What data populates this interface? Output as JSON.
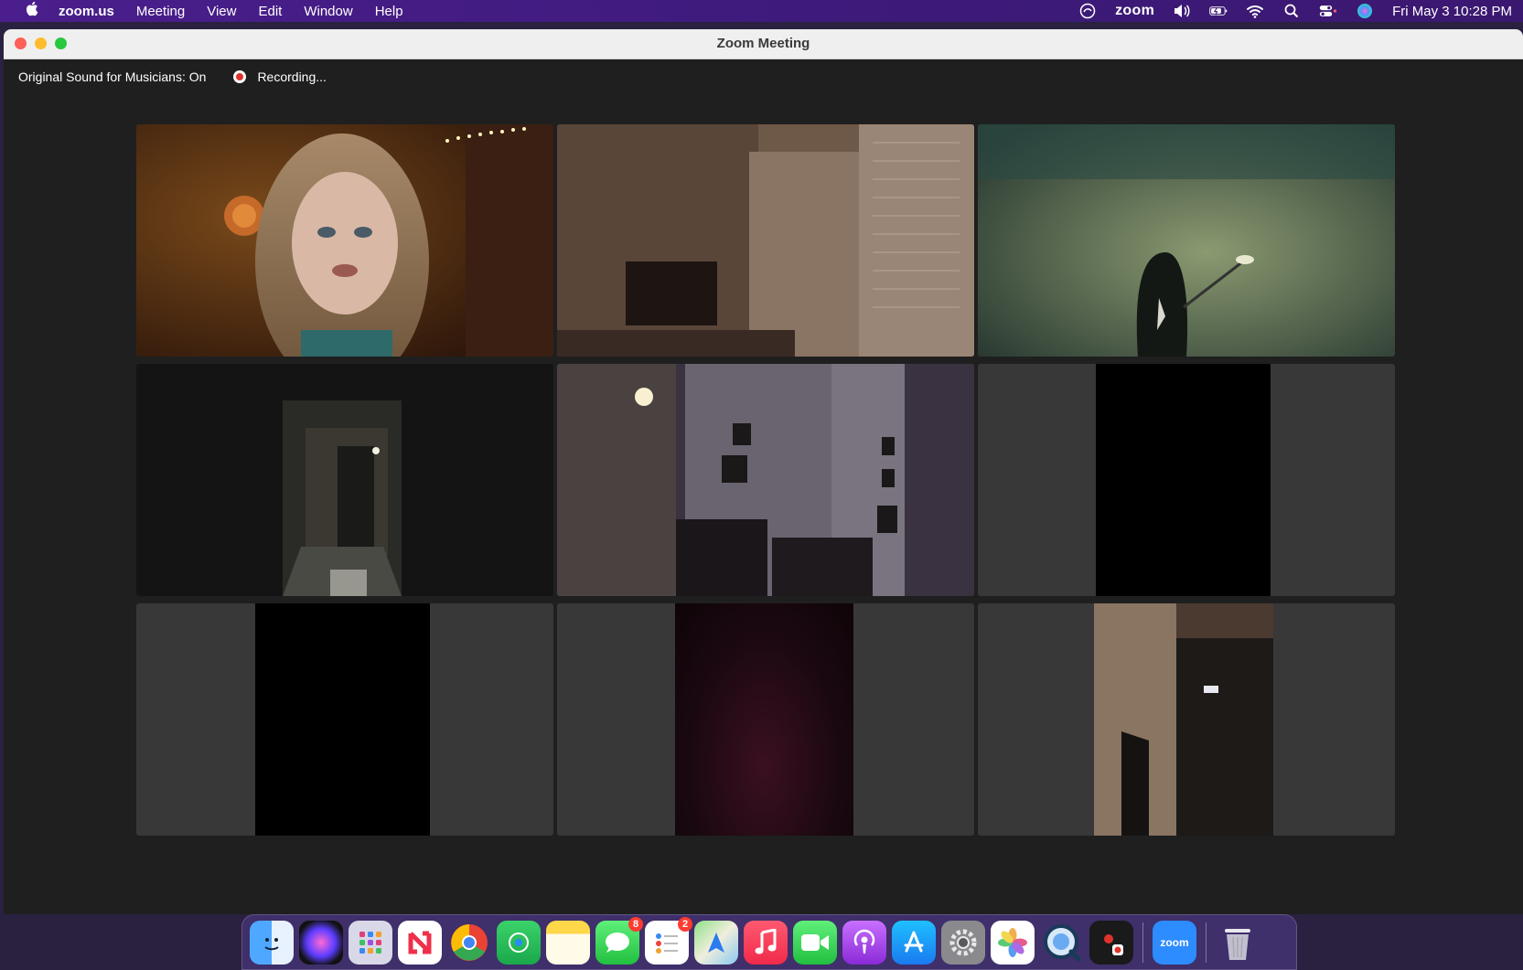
{
  "menubar": {
    "app_name": "zoom.us",
    "items": [
      "Meeting",
      "View",
      "Edit",
      "Window",
      "Help"
    ],
    "zoom_status": "zoom",
    "clock": "Fri May 3  10:28 PM"
  },
  "window": {
    "title": "Zoom Meeting",
    "status_sound": "Original Sound for Musicians: On",
    "status_recording": "Recording..."
  },
  "dock": {
    "apps": [
      "finder-icon",
      "siri-icon",
      "launchpad-icon",
      "news-icon",
      "chrome-icon",
      "find-my-icon",
      "notes-icon",
      "messages-icon",
      "reminders-icon",
      "maps-icon",
      "music-icon",
      "facetime-icon",
      "podcasts-icon",
      "app-store-icon",
      "system-settings-icon",
      "photos-icon",
      "quicktime-icon",
      "screen-recorder-icon"
    ],
    "messages_badge": "8",
    "reminders_badge": "2",
    "zoom_label": "zoom"
  }
}
